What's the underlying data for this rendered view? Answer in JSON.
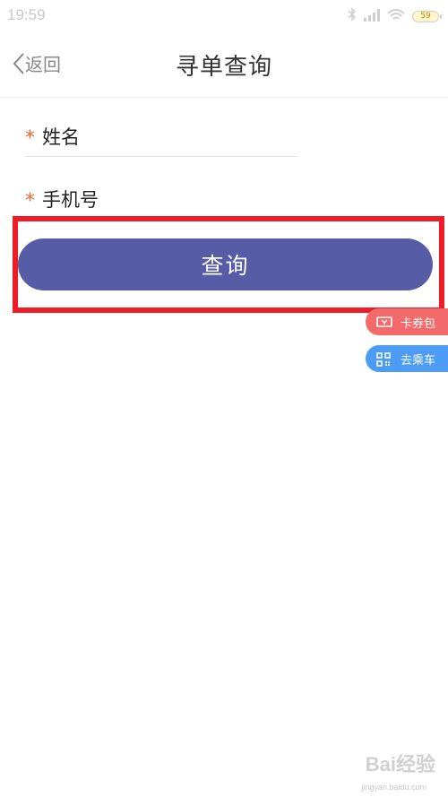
{
  "status_bar": {
    "time": "19:59",
    "battery": "59"
  },
  "navbar": {
    "back_label": "返回",
    "title": "寻单查询"
  },
  "form": {
    "required_mark": "*",
    "fields": [
      {
        "label": "姓名"
      },
      {
        "label": "手机号"
      }
    ],
    "submit_label": "查询"
  },
  "floating": {
    "coupon_label": "卡券包",
    "ride_label": "去乘车"
  },
  "watermark": {
    "brand": "Bai经验",
    "url": "jingyan.baidu.com"
  },
  "colors": {
    "primary_button": "#565ca5",
    "highlight_border": "#ee1c25",
    "required": "#f0672d",
    "coupon": "#f36a6a",
    "ride": "#4c9cf5"
  }
}
